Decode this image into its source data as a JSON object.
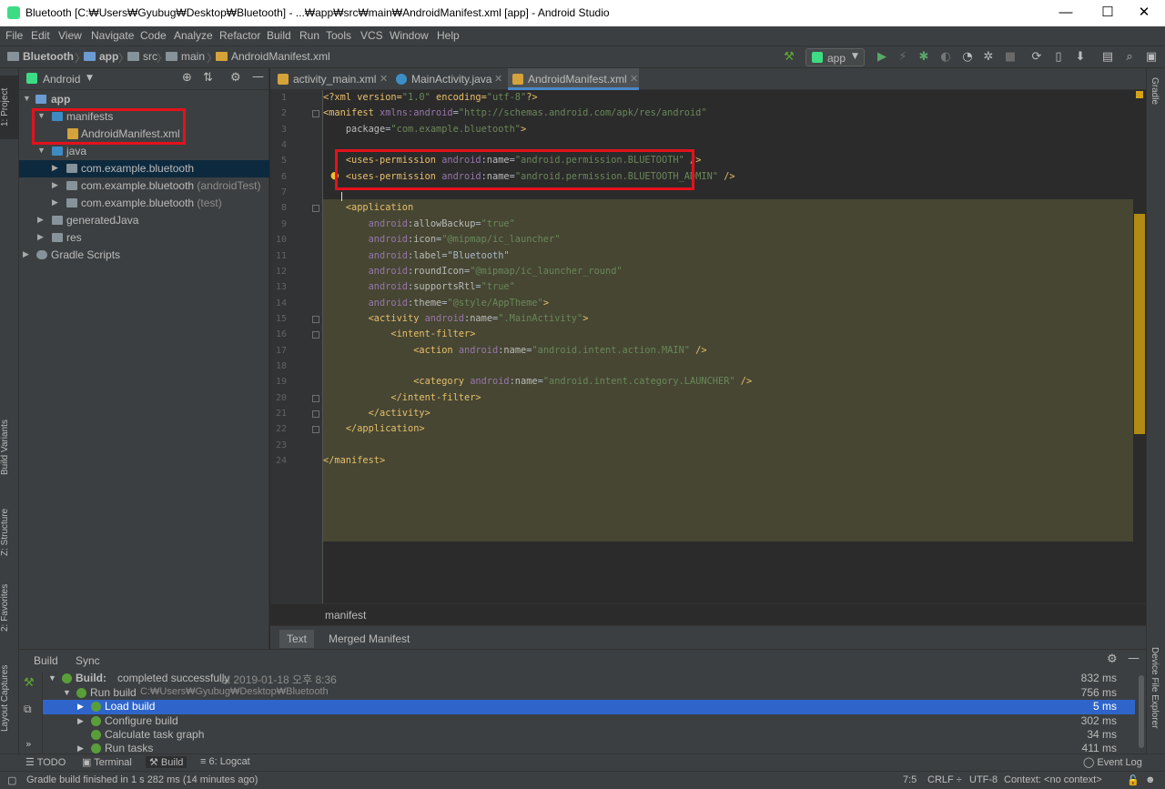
{
  "window": {
    "title": "Bluetooth [C:₩Users₩Gyubug₩Desktop₩Bluetooth] - ...₩app₩src₩main₩AndroidManifest.xml [app] - Android Studio",
    "minimize": "—",
    "maximize": "☐",
    "close": "✕"
  },
  "menu": [
    "File",
    "Edit",
    "View",
    "Navigate",
    "Code",
    "Analyze",
    "Refactor",
    "Build",
    "Run",
    "Tools",
    "VCS",
    "Window",
    "Help"
  ],
  "navbar": {
    "crumbs": [
      "Bluetooth",
      "app",
      "src",
      "main",
      "AndroidManifest.xml"
    ],
    "run_config": "app"
  },
  "left_stripe": [
    "1: Project",
    "Build Variants",
    "Z: Structure",
    "2: Favorites",
    "Layout Captures"
  ],
  "right_stripe": [
    "Gradle",
    "Device File Explorer"
  ],
  "project": {
    "view": "Android",
    "tree": [
      {
        "label": "app",
        "bold": true
      },
      {
        "label": "manifests"
      },
      {
        "label": "AndroidManifest.xml"
      },
      {
        "label": "java"
      },
      {
        "label": "com.example.bluetooth",
        "suffix": ""
      },
      {
        "label": "com.example.bluetooth",
        "suffix": "(androidTest)"
      },
      {
        "label": "com.example.bluetooth",
        "suffix": "(test)"
      },
      {
        "label": "generatedJava"
      },
      {
        "label": "res"
      },
      {
        "label": "Gradle Scripts"
      }
    ]
  },
  "editor": {
    "tabs": [
      "activity_main.xml",
      "MainActivity.java",
      "AndroidManifest.xml"
    ],
    "active_tab": 2,
    "line_numbers": [
      "1",
      "2",
      "3",
      "4",
      "5",
      "6",
      "7",
      "8",
      "9",
      "10",
      "11",
      "12",
      "13",
      "14",
      "15",
      "16",
      "17",
      "18",
      "19",
      "20",
      "21",
      "22",
      "23",
      "24"
    ],
    "lines": [
      [
        [
          "t",
          "<?xml version="
        ],
        [
          "v",
          "\"1.0\""
        ],
        [
          "t",
          " encoding="
        ],
        [
          "v",
          "\"utf-8\""
        ],
        [
          "t",
          "?>"
        ]
      ],
      [
        [
          "t",
          "<manifest "
        ],
        [
          "ns",
          "xmlns:android"
        ],
        [
          "p",
          "="
        ],
        [
          "v",
          "\"http://schemas.android.com/apk/res/android\""
        ]
      ],
      [
        [
          "p",
          "    "
        ],
        [
          "at",
          "package"
        ],
        [
          "p",
          "="
        ],
        [
          "v",
          "\"com.example.bluetooth\""
        ],
        [
          "t",
          ">"
        ]
      ],
      [],
      [
        [
          "p",
          "    "
        ],
        [
          "t",
          "<uses-permission "
        ],
        [
          "ns",
          "android"
        ],
        [
          "at",
          ":name"
        ],
        [
          "p",
          "="
        ],
        [
          "v",
          "\"android.permission.BLUETOOTH\""
        ],
        [
          "t",
          " />"
        ]
      ],
      [
        [
          "p",
          "    "
        ],
        [
          "t",
          "<uses-permission "
        ],
        [
          "ns",
          "android"
        ],
        [
          "at",
          ":name"
        ],
        [
          "p",
          "="
        ],
        [
          "v",
          "\"android.permission.BLUETOOTH_ADMIN\""
        ],
        [
          "t",
          " />"
        ]
      ],
      [],
      [
        [
          "p",
          "    "
        ],
        [
          "t",
          "<application"
        ]
      ],
      [
        [
          "p",
          "        "
        ],
        [
          "ns",
          "android"
        ],
        [
          "at",
          ":allowBackup"
        ],
        [
          "p",
          "="
        ],
        [
          "v",
          "\"true\""
        ]
      ],
      [
        [
          "p",
          "        "
        ],
        [
          "ns",
          "android"
        ],
        [
          "at",
          ":icon"
        ],
        [
          "p",
          "="
        ],
        [
          "v",
          "\"@mipmap/ic_launcher\""
        ]
      ],
      [
        [
          "p",
          "        "
        ],
        [
          "ns",
          "android"
        ],
        [
          "at",
          ":label"
        ],
        [
          "p",
          "="
        ],
        [
          "p",
          "\"Bluetooth\""
        ]
      ],
      [
        [
          "p",
          "        "
        ],
        [
          "ns",
          "android"
        ],
        [
          "at",
          ":roundIcon"
        ],
        [
          "p",
          "="
        ],
        [
          "v",
          "\"@mipmap/ic_launcher_round\""
        ]
      ],
      [
        [
          "p",
          "        "
        ],
        [
          "ns",
          "android"
        ],
        [
          "at",
          ":supportsRtl"
        ],
        [
          "p",
          "="
        ],
        [
          "v",
          "\"true\""
        ]
      ],
      [
        [
          "p",
          "        "
        ],
        [
          "ns",
          "android"
        ],
        [
          "at",
          ":theme"
        ],
        [
          "p",
          "="
        ],
        [
          "v",
          "\"@style/AppTheme\""
        ],
        [
          "t",
          ">"
        ]
      ],
      [
        [
          "p",
          "        "
        ],
        [
          "t",
          "<activity "
        ],
        [
          "ns",
          "android"
        ],
        [
          "at",
          ":name"
        ],
        [
          "p",
          "="
        ],
        [
          "v",
          "\".MainActivity\""
        ],
        [
          "t",
          ">"
        ]
      ],
      [
        [
          "p",
          "            "
        ],
        [
          "t",
          "<intent-filter>"
        ]
      ],
      [
        [
          "p",
          "                "
        ],
        [
          "t",
          "<action "
        ],
        [
          "ns",
          "android"
        ],
        [
          "at",
          ":name"
        ],
        [
          "p",
          "="
        ],
        [
          "v",
          "\"android.intent.action.MAIN\""
        ],
        [
          "t",
          " />"
        ]
      ],
      [],
      [
        [
          "p",
          "                "
        ],
        [
          "t",
          "<category "
        ],
        [
          "ns",
          "android"
        ],
        [
          "at",
          ":name"
        ],
        [
          "p",
          "="
        ],
        [
          "v",
          "\"android.intent.category.LAUNCHER\""
        ],
        [
          "t",
          " />"
        ]
      ],
      [
        [
          "p",
          "            "
        ],
        [
          "t",
          "</intent-filter>"
        ]
      ],
      [
        [
          "p",
          "        "
        ],
        [
          "t",
          "</activity>"
        ]
      ],
      [
        [
          "p",
          "    "
        ],
        [
          "t",
          "</application>"
        ]
      ],
      [],
      [
        [
          "t",
          "</manifest>"
        ]
      ]
    ],
    "breadcrumb": "manifest",
    "bottom_tabs": [
      "Text",
      "Merged Manifest"
    ]
  },
  "build": {
    "tabs": [
      "Build",
      "Sync"
    ],
    "rows": [
      {
        "label": "Build:",
        "extra": "completed successfully",
        "time": "at 2019-01-18 오후 8:36",
        "duration": "832 ms"
      },
      {
        "label": "Run build",
        "extra": "C:₩Users₩Gyubug₩Desktop₩Bluetooth",
        "time": "",
        "duration": "756 ms"
      },
      {
        "label": "Load build",
        "extra": "",
        "time": "",
        "duration": "5 ms"
      },
      {
        "label": "Configure build",
        "extra": "",
        "time": "",
        "duration": "302 ms"
      },
      {
        "label": "Calculate task graph",
        "extra": "",
        "time": "",
        "duration": "34 ms"
      },
      {
        "label": "Run tasks",
        "extra": "",
        "time": "",
        "duration": "411 ms"
      }
    ]
  },
  "toolwindows": [
    "TODO",
    "Terminal",
    "Build",
    "6: Logcat",
    "Event Log"
  ],
  "status": {
    "message": "Gradle build finished in 1 s 282 ms (14 minutes ago)",
    "position": "7:5",
    "line_sep": "CRLF ÷",
    "encoding": "UTF-8",
    "context": "Context: <no context>"
  },
  "colors": {
    "highlight_box": "#e3121c",
    "selection": "#2f65ca",
    "tag": "#e8bf6a",
    "value": "#6a8759"
  }
}
